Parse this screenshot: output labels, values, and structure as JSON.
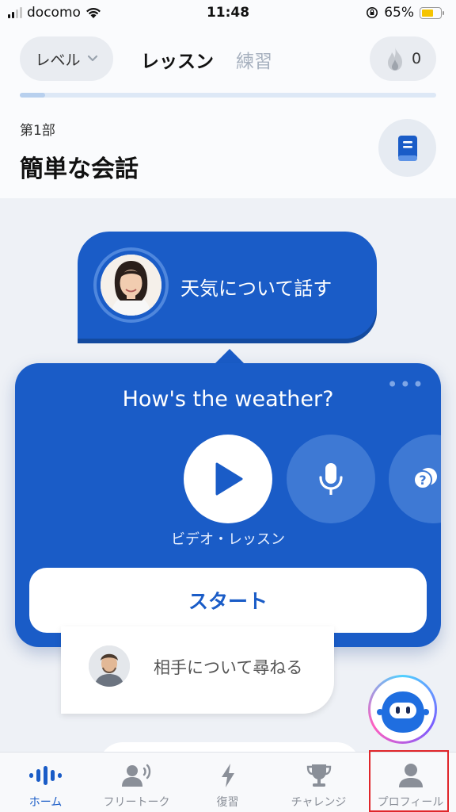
{
  "status_bar": {
    "carrier": "docomo",
    "time": "11:48",
    "battery_percent": "65%",
    "battery_level": 0.65
  },
  "header": {
    "level_label": "レベル",
    "tab_lesson": "レッスン",
    "tab_practice": "練習",
    "streak_count": "0",
    "progress_fraction": 0.06
  },
  "unit": {
    "part_label": "第1部",
    "title": "簡単な会話"
  },
  "lesson_node": {
    "title": "天気について話す"
  },
  "popup": {
    "phrase": "How's the weather?",
    "activity_label": "ビデオ・レッスン",
    "start_label": "スタート"
  },
  "next_lesson": {
    "title": "相手について尋ねる"
  },
  "bottom_nav": {
    "items": [
      {
        "label": "ホーム",
        "icon": "waveform-icon"
      },
      {
        "label": "フリートーク",
        "icon": "person-speaking-icon"
      },
      {
        "label": "復習",
        "icon": "lightning-icon"
      },
      {
        "label": "チャレンジ",
        "icon": "trophy-icon"
      },
      {
        "label": "プロフィール",
        "icon": "person-icon"
      }
    ]
  },
  "colors": {
    "primary": "#1a5cc7",
    "highlight": "#e0262b"
  }
}
